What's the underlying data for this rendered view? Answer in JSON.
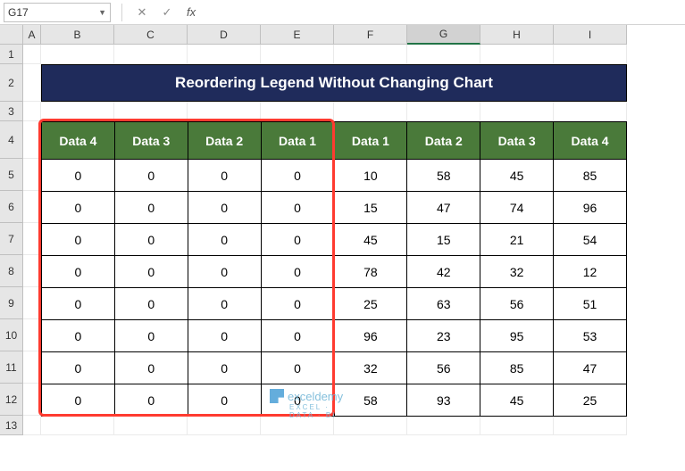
{
  "namebox": {
    "ref": "G17"
  },
  "formula_bar": {
    "fx_label": "fx",
    "value": ""
  },
  "columns": [
    {
      "letter": "A",
      "width": 20
    },
    {
      "letter": "B",
      "width": 82
    },
    {
      "letter": "C",
      "width": 82
    },
    {
      "letter": "D",
      "width": 82
    },
    {
      "letter": "E",
      "width": 82
    },
    {
      "letter": "F",
      "width": 82
    },
    {
      "letter": "G",
      "width": 82
    },
    {
      "letter": "H",
      "width": 82
    },
    {
      "letter": "I",
      "width": 82
    }
  ],
  "rows": [
    {
      "n": 1,
      "h": 22
    },
    {
      "n": 2,
      "h": 42
    },
    {
      "n": 3,
      "h": 22
    },
    {
      "n": 4,
      "h": 42
    },
    {
      "n": 5,
      "h": 36
    },
    {
      "n": 6,
      "h": 36
    },
    {
      "n": 7,
      "h": 36
    },
    {
      "n": 8,
      "h": 36
    },
    {
      "n": 9,
      "h": 36
    },
    {
      "n": 10,
      "h": 36
    },
    {
      "n": 11,
      "h": 36
    },
    {
      "n": 12,
      "h": 36
    },
    {
      "n": 13,
      "h": 22
    }
  ],
  "title": "Reordering Legend Without Changing Chart",
  "table": {
    "headers": [
      "Data 4",
      "Data 3",
      "Data 2",
      "Data 1",
      "Data 1",
      "Data 2",
      "Data 3",
      "Data 4"
    ],
    "rows": [
      [
        0,
        0,
        0,
        0,
        10,
        58,
        45,
        85
      ],
      [
        0,
        0,
        0,
        0,
        15,
        47,
        74,
        96
      ],
      [
        0,
        0,
        0,
        0,
        45,
        15,
        21,
        54
      ],
      [
        0,
        0,
        0,
        0,
        78,
        42,
        32,
        12
      ],
      [
        0,
        0,
        0,
        0,
        25,
        63,
        56,
        51
      ],
      [
        0,
        0,
        0,
        0,
        96,
        23,
        95,
        53
      ],
      [
        0,
        0,
        0,
        0,
        32,
        56,
        85,
        47
      ],
      [
        0,
        0,
        0,
        0,
        58,
        93,
        45,
        25
      ]
    ]
  },
  "active_cell": {
    "col": "G",
    "row": 17
  },
  "watermark": {
    "brand": "exceldemy",
    "tag": "EXCEL · DATA · BI"
  }
}
